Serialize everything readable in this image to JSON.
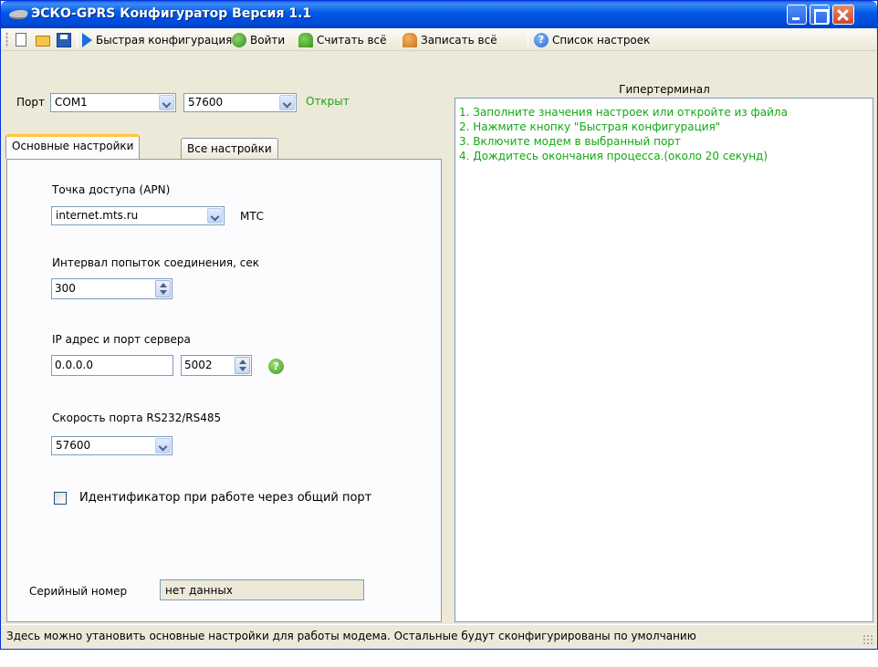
{
  "window": {
    "title": "ЭСКО-GPRS Конфигуратор Версия 1.1"
  },
  "toolbar": {
    "quick_config": "Быстрая конфигурация",
    "login": "Войти",
    "read_all": "Считать всё",
    "write_all": "Записать всё",
    "settings_list": "Список настроек"
  },
  "port": {
    "label": "Порт",
    "com": "COM1",
    "baud": "57600",
    "status": "Открыт",
    "status_color": "#13a813"
  },
  "tabs": [
    {
      "label": "Основные настройки",
      "active": true
    },
    {
      "label": "Все настройки",
      "active": false
    }
  ],
  "form": {
    "apn_label": "Точка доступа (APN)",
    "apn_value": "internet.mts.ru",
    "apn_operator": "МТС",
    "interval_label": "Интервал попыток соединения, сек",
    "interval_value": "300",
    "server_label": "IP адрес и порт сервера",
    "server_ip": "0.0.0.0",
    "server_port": "5002",
    "rs_label": "Скорость порта RS232/RS485",
    "rs_value": "57600",
    "identifier_label": "Идентификатор при работе через общий порт",
    "identifier_checked": false,
    "serial_label": "Серийный номер",
    "serial_value": "нет данных"
  },
  "terminal": {
    "title": "Гипертерминал",
    "lines": [
      "1. Заполните значения настроек или откройте из файла",
      "2. Нажмите кнопку \"Быстрая конфигурация\"",
      "3. Включите модем в выбранный порт",
      "4. Дождитесь окончания процесса.(около 20 секунд)"
    ],
    "text_color": "#13a813"
  },
  "status_bar": {
    "text": "Здесь можно утановить основные настройки для работы модема. Остальные будут сконфигурированы по умолчанию"
  },
  "colors": {
    "titlebar": "#0058e6",
    "window_bg": "#ece9d8",
    "tab_highlight": "#ffc83c"
  }
}
